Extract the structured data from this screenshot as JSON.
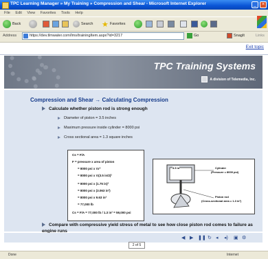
{
  "window": {
    "title": "TPC Learning Manager » My Training » Compression and Shear - Microsoft Internet Explorer",
    "menus": [
      "File",
      "Edit",
      "View",
      "Favorites",
      "Tools",
      "Help"
    ],
    "toolbar": {
      "back": "Back",
      "search": "Search",
      "favorites": "Favorites"
    },
    "address_label": "Address",
    "address_value": "https://dev.tlmwater.com/lms/trainingItem.aspx?id=3217",
    "go_label": "Go",
    "snagit_label": "SnagIt",
    "links_label": "Links",
    "status_done": "Done",
    "status_zone": "Internet"
  },
  "page": {
    "exit_link": "Exit topic",
    "brand": "TPC Training Systems",
    "brand_sub": "A division of Telemedia, Inc.",
    "heading": "Compression and Shear → Calculating Compression",
    "bullet_main": "Calculate whether piston rod is strong enough",
    "sub_bullets": [
      "Diameter of piston = 3.5 inches",
      "Maximum pressure inside cylinder = 8000 psi",
      "Cross sectional area = 1.3 square inches"
    ],
    "calc_lines": {
      "l1": "Cs = F/A",
      "l2": "F = pressure x area of piston",
      "l3": "= 8000 psi x πr²",
      "l4": "= 8000 psi x π(3.5 in/2)²",
      "l5": "= 8000 psi x (1.75 in)²",
      "l6": "= 8000 psi x (3.063 in²)",
      "l7": "= 8000 psi x 9.63 in²",
      "l8": "= 77,000 lb",
      "l9": "Cs = F/A = 77,000 lb / 1.3 in² = 59,000 psi"
    },
    "diagram": {
      "dim": "3.5 in",
      "cyl_label": "Cylinder",
      "cyl_sub": "(Pressure = 8000 psi)",
      "rod_label": "Piston rod",
      "rod_sub": "(Cross-sectional area = 1.3 in²)"
    },
    "bottom_bullet": "Compare with compressive yield stress of metal to see how close piston rod comes to failure as engine runs",
    "page_indicator": "2 of 5"
  }
}
